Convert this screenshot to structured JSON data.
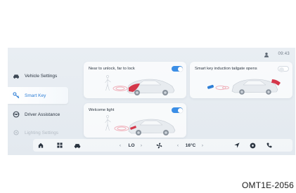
{
  "status": {
    "time": "09:43",
    "icon": "user-icon"
  },
  "sidebar": {
    "items": [
      {
        "label": "Vehicle Settings",
        "icon": "car-icon",
        "active": false
      },
      {
        "label": "Smart Key",
        "icon": "key-icon",
        "active": true
      },
      {
        "label": "Driver Assistance",
        "icon": "steering-wheel-icon",
        "active": false
      },
      {
        "label": "Lighting Settings",
        "icon": "light-icon",
        "active": false
      }
    ]
  },
  "cards": {
    "near_unlock": {
      "title": "Near to unlock, far to lock",
      "enabled": true
    },
    "tailgate": {
      "title": "Smart key induction tailgate opens",
      "enabled": false
    },
    "welcome_light": {
      "title": "Welcome light",
      "enabled": true
    }
  },
  "bottombar": {
    "fan_level": "LO",
    "temperature": "16°C",
    "left_arrow": "‹",
    "right_arrow": "›",
    "icons": [
      "home-icon",
      "apps-icon",
      "car-icon",
      "fan-icon",
      "navigation-icon",
      "media-icon",
      "phone-icon"
    ]
  },
  "colors": {
    "accent": "#3b8ee6",
    "active_text": "#2f7fd6"
  },
  "caption": "OMT1E-2056"
}
